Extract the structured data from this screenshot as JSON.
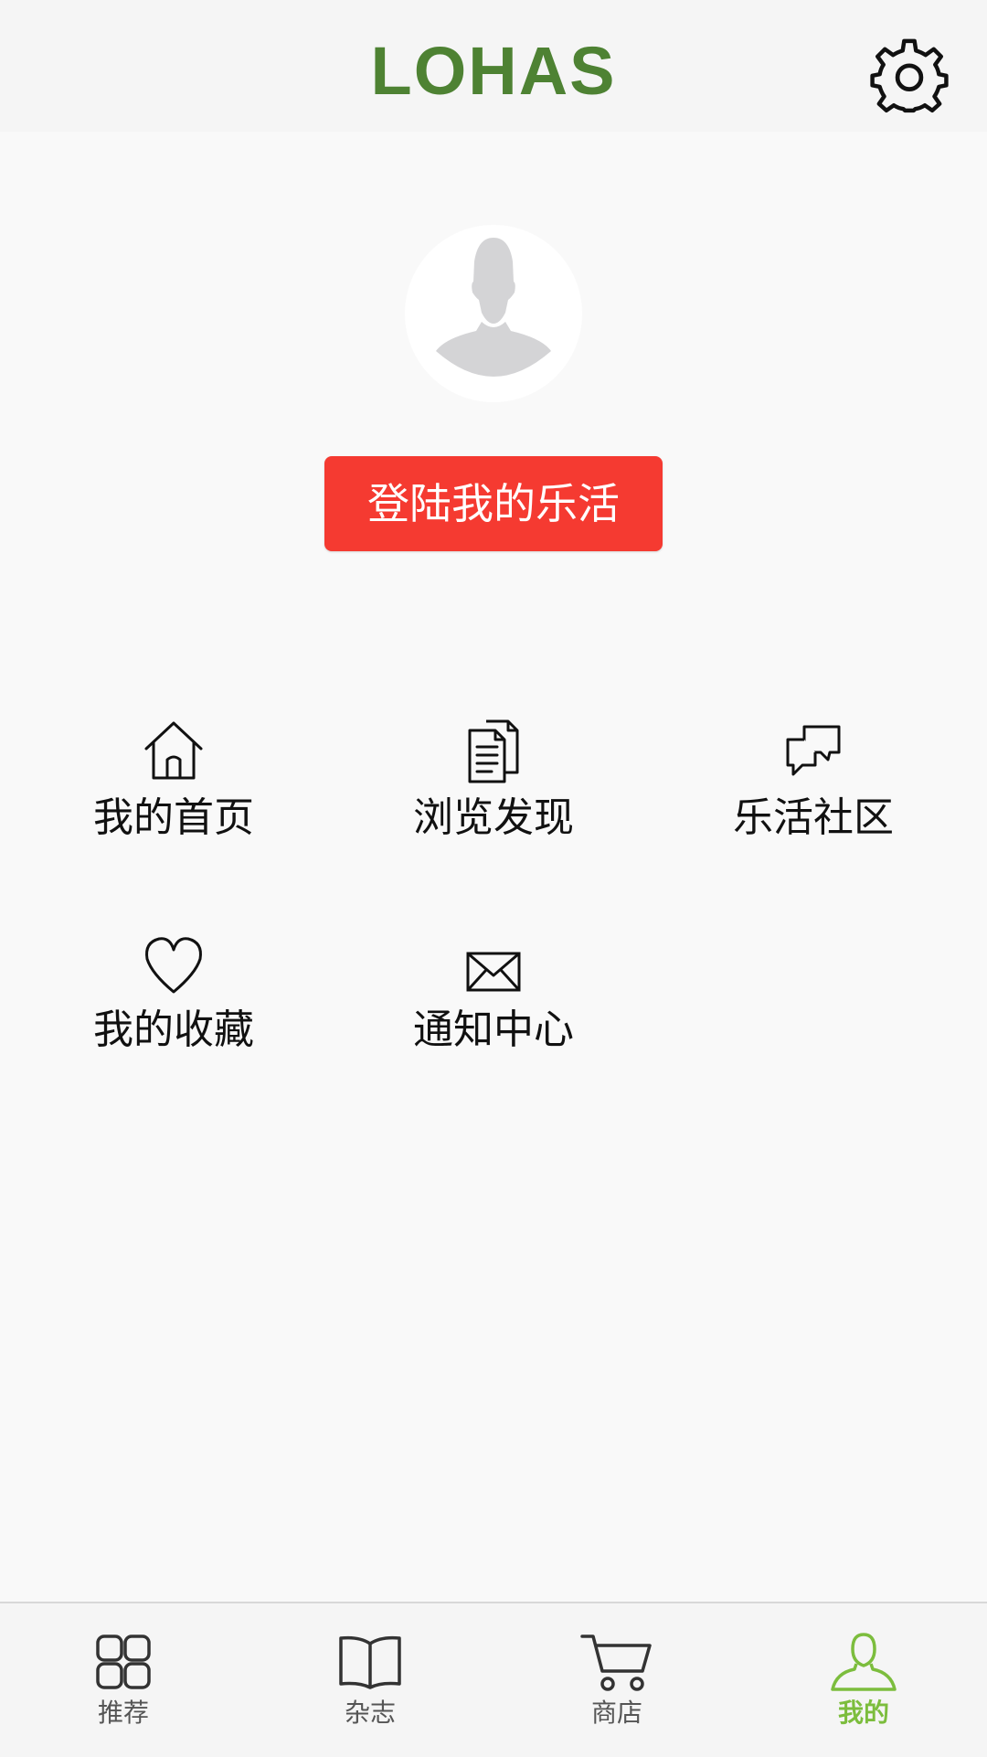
{
  "colors": {
    "brand_green": "#4e8233",
    "accent_red": "#f53a31",
    "tab_active": "#7cbd3d",
    "icon_dark": "#111111",
    "tab_inactive": "#555555"
  },
  "header": {
    "logo_text": "LOHAS",
    "settings_icon": "gear-icon"
  },
  "profile": {
    "avatar_icon": "default-avatar-icon",
    "login_label": "登陆我的乐活"
  },
  "menu": {
    "items": [
      {
        "label": "我的首页",
        "icon": "home-icon"
      },
      {
        "label": "浏览发现",
        "icon": "document-icon"
      },
      {
        "label": "乐活社区",
        "icon": "chat-icon"
      },
      {
        "label": "我的收藏",
        "icon": "heart-icon"
      },
      {
        "label": "通知中心",
        "icon": "mail-icon"
      }
    ]
  },
  "tabbar": {
    "items": [
      {
        "label": "推荐",
        "icon": "grid-icon",
        "active": false
      },
      {
        "label": "杂志",
        "icon": "book-icon",
        "active": false
      },
      {
        "label": "商店",
        "icon": "cart-icon",
        "active": false
      },
      {
        "label": "我的",
        "icon": "person-icon",
        "active": true
      }
    ]
  }
}
